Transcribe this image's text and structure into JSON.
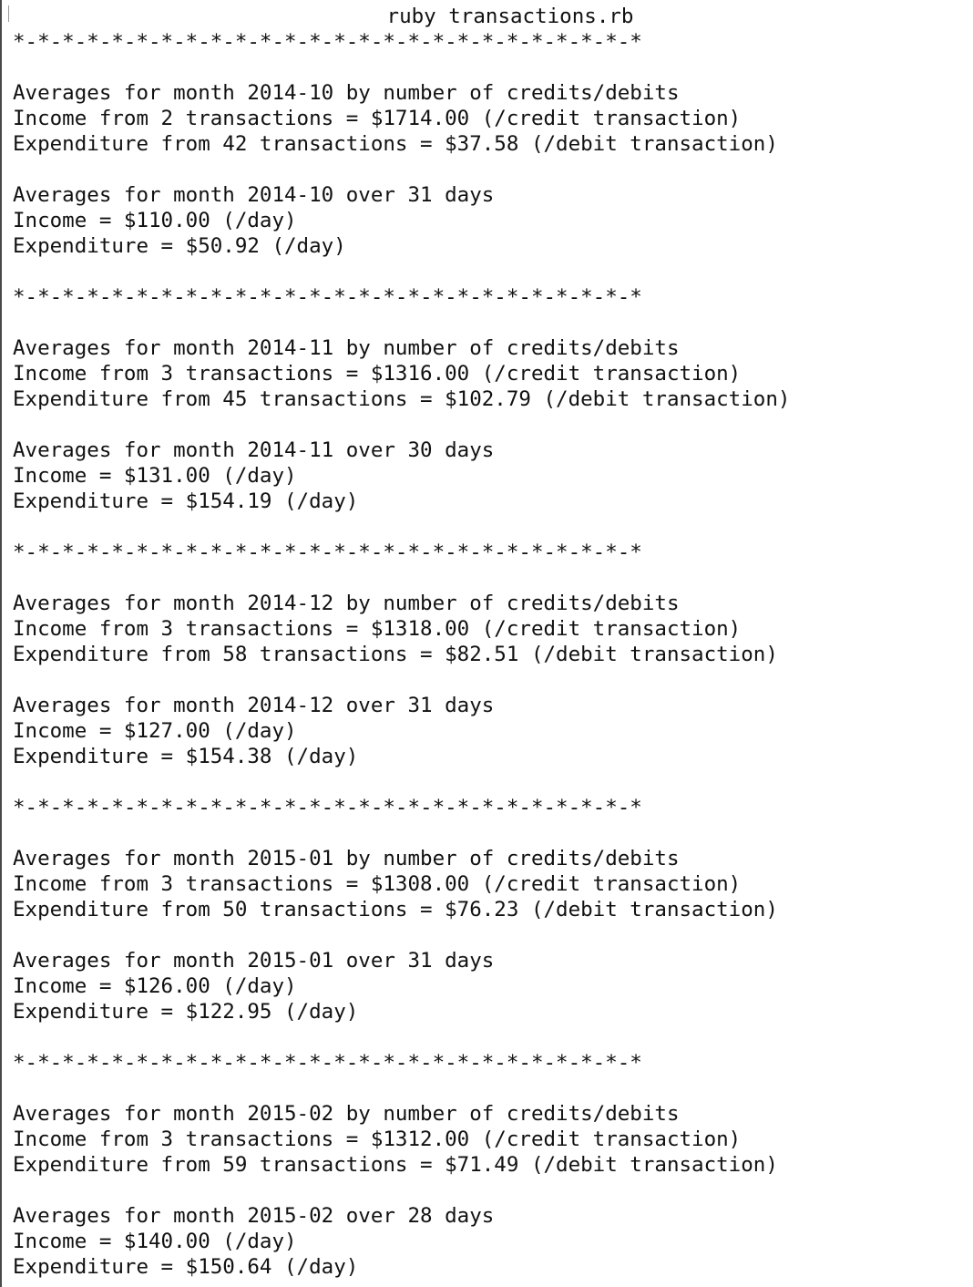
{
  "window": {
    "title": "ruby transactions.rb"
  },
  "output_lines": [
    "*-*-*-*-*-*-*-*-*-*-*-*-*-*-*-*-*-*-*-*-*-*-*-*-*-*",
    "",
    "Averages for month 2014-10 by number of credits/debits",
    "Income from 2 transactions = $1714.00 (/credit transaction)",
    "Expenditure from 42 transactions = $37.58 (/debit transaction)",
    "",
    "Averages for month 2014-10 over 31 days",
    "Income = $110.00 (/day)",
    "Expenditure = $50.92 (/day)",
    "",
    "*-*-*-*-*-*-*-*-*-*-*-*-*-*-*-*-*-*-*-*-*-*-*-*-*-*",
    "",
    "Averages for month 2014-11 by number of credits/debits",
    "Income from 3 transactions = $1316.00 (/credit transaction)",
    "Expenditure from 45 transactions = $102.79 (/debit transaction)",
    "",
    "Averages for month 2014-11 over 30 days",
    "Income = $131.00 (/day)",
    "Expenditure = $154.19 (/day)",
    "",
    "*-*-*-*-*-*-*-*-*-*-*-*-*-*-*-*-*-*-*-*-*-*-*-*-*-*",
    "",
    "Averages for month 2014-12 by number of credits/debits",
    "Income from 3 transactions = $1318.00 (/credit transaction)",
    "Expenditure from 58 transactions = $82.51 (/debit transaction)",
    "",
    "Averages for month 2014-12 over 31 days",
    "Income = $127.00 (/day)",
    "Expenditure = $154.38 (/day)",
    "",
    "*-*-*-*-*-*-*-*-*-*-*-*-*-*-*-*-*-*-*-*-*-*-*-*-*-*",
    "",
    "Averages for month 2015-01 by number of credits/debits",
    "Income from 3 transactions = $1308.00 (/credit transaction)",
    "Expenditure from 50 transactions = $76.23 (/debit transaction)",
    "",
    "Averages for month 2015-01 over 31 days",
    "Income = $126.00 (/day)",
    "Expenditure = $122.95 (/day)",
    "",
    "*-*-*-*-*-*-*-*-*-*-*-*-*-*-*-*-*-*-*-*-*-*-*-*-*-*",
    "",
    "Averages for month 2015-02 by number of credits/debits",
    "Income from 3 transactions = $1312.00 (/credit transaction)",
    "Expenditure from 59 transactions = $71.49 (/debit transaction)",
    "",
    "Averages for month 2015-02 over 28 days",
    "Income = $140.00 (/day)",
    "Expenditure = $150.64 (/day)"
  ]
}
